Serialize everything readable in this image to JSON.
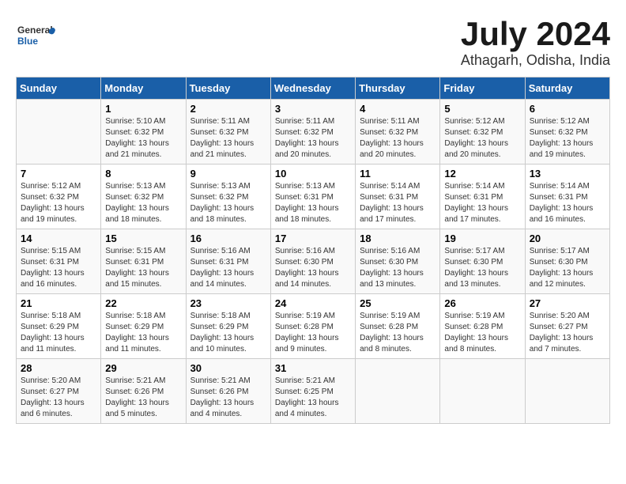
{
  "header": {
    "logo_general": "General",
    "logo_blue": "Blue",
    "month": "July 2024",
    "location": "Athagarh, Odisha, India"
  },
  "days_of_week": [
    "Sunday",
    "Monday",
    "Tuesday",
    "Wednesday",
    "Thursday",
    "Friday",
    "Saturday"
  ],
  "weeks": [
    [
      {
        "day": "",
        "info": ""
      },
      {
        "day": "1",
        "info": "Sunrise: 5:10 AM\nSunset: 6:32 PM\nDaylight: 13 hours\nand 21 minutes."
      },
      {
        "day": "2",
        "info": "Sunrise: 5:11 AM\nSunset: 6:32 PM\nDaylight: 13 hours\nand 21 minutes."
      },
      {
        "day": "3",
        "info": "Sunrise: 5:11 AM\nSunset: 6:32 PM\nDaylight: 13 hours\nand 20 minutes."
      },
      {
        "day": "4",
        "info": "Sunrise: 5:11 AM\nSunset: 6:32 PM\nDaylight: 13 hours\nand 20 minutes."
      },
      {
        "day": "5",
        "info": "Sunrise: 5:12 AM\nSunset: 6:32 PM\nDaylight: 13 hours\nand 20 minutes."
      },
      {
        "day": "6",
        "info": "Sunrise: 5:12 AM\nSunset: 6:32 PM\nDaylight: 13 hours\nand 19 minutes."
      }
    ],
    [
      {
        "day": "7",
        "info": "Sunrise: 5:12 AM\nSunset: 6:32 PM\nDaylight: 13 hours\nand 19 minutes."
      },
      {
        "day": "8",
        "info": "Sunrise: 5:13 AM\nSunset: 6:32 PM\nDaylight: 13 hours\nand 18 minutes."
      },
      {
        "day": "9",
        "info": "Sunrise: 5:13 AM\nSunset: 6:32 PM\nDaylight: 13 hours\nand 18 minutes."
      },
      {
        "day": "10",
        "info": "Sunrise: 5:13 AM\nSunset: 6:31 PM\nDaylight: 13 hours\nand 18 minutes."
      },
      {
        "day": "11",
        "info": "Sunrise: 5:14 AM\nSunset: 6:31 PM\nDaylight: 13 hours\nand 17 minutes."
      },
      {
        "day": "12",
        "info": "Sunrise: 5:14 AM\nSunset: 6:31 PM\nDaylight: 13 hours\nand 17 minutes."
      },
      {
        "day": "13",
        "info": "Sunrise: 5:14 AM\nSunset: 6:31 PM\nDaylight: 13 hours\nand 16 minutes."
      }
    ],
    [
      {
        "day": "14",
        "info": "Sunrise: 5:15 AM\nSunset: 6:31 PM\nDaylight: 13 hours\nand 16 minutes."
      },
      {
        "day": "15",
        "info": "Sunrise: 5:15 AM\nSunset: 6:31 PM\nDaylight: 13 hours\nand 15 minutes."
      },
      {
        "day": "16",
        "info": "Sunrise: 5:16 AM\nSunset: 6:31 PM\nDaylight: 13 hours\nand 14 minutes."
      },
      {
        "day": "17",
        "info": "Sunrise: 5:16 AM\nSunset: 6:30 PM\nDaylight: 13 hours\nand 14 minutes."
      },
      {
        "day": "18",
        "info": "Sunrise: 5:16 AM\nSunset: 6:30 PM\nDaylight: 13 hours\nand 13 minutes."
      },
      {
        "day": "19",
        "info": "Sunrise: 5:17 AM\nSunset: 6:30 PM\nDaylight: 13 hours\nand 13 minutes."
      },
      {
        "day": "20",
        "info": "Sunrise: 5:17 AM\nSunset: 6:30 PM\nDaylight: 13 hours\nand 12 minutes."
      }
    ],
    [
      {
        "day": "21",
        "info": "Sunrise: 5:18 AM\nSunset: 6:29 PM\nDaylight: 13 hours\nand 11 minutes."
      },
      {
        "day": "22",
        "info": "Sunrise: 5:18 AM\nSunset: 6:29 PM\nDaylight: 13 hours\nand 11 minutes."
      },
      {
        "day": "23",
        "info": "Sunrise: 5:18 AM\nSunset: 6:29 PM\nDaylight: 13 hours\nand 10 minutes."
      },
      {
        "day": "24",
        "info": "Sunrise: 5:19 AM\nSunset: 6:28 PM\nDaylight: 13 hours\nand 9 minutes."
      },
      {
        "day": "25",
        "info": "Sunrise: 5:19 AM\nSunset: 6:28 PM\nDaylight: 13 hours\nand 8 minutes."
      },
      {
        "day": "26",
        "info": "Sunrise: 5:19 AM\nSunset: 6:28 PM\nDaylight: 13 hours\nand 8 minutes."
      },
      {
        "day": "27",
        "info": "Sunrise: 5:20 AM\nSunset: 6:27 PM\nDaylight: 13 hours\nand 7 minutes."
      }
    ],
    [
      {
        "day": "28",
        "info": "Sunrise: 5:20 AM\nSunset: 6:27 PM\nDaylight: 13 hours\nand 6 minutes."
      },
      {
        "day": "29",
        "info": "Sunrise: 5:21 AM\nSunset: 6:26 PM\nDaylight: 13 hours\nand 5 minutes."
      },
      {
        "day": "30",
        "info": "Sunrise: 5:21 AM\nSunset: 6:26 PM\nDaylight: 13 hours\nand 4 minutes."
      },
      {
        "day": "31",
        "info": "Sunrise: 5:21 AM\nSunset: 6:25 PM\nDaylight: 13 hours\nand 4 minutes."
      },
      {
        "day": "",
        "info": ""
      },
      {
        "day": "",
        "info": ""
      },
      {
        "day": "",
        "info": ""
      }
    ]
  ]
}
